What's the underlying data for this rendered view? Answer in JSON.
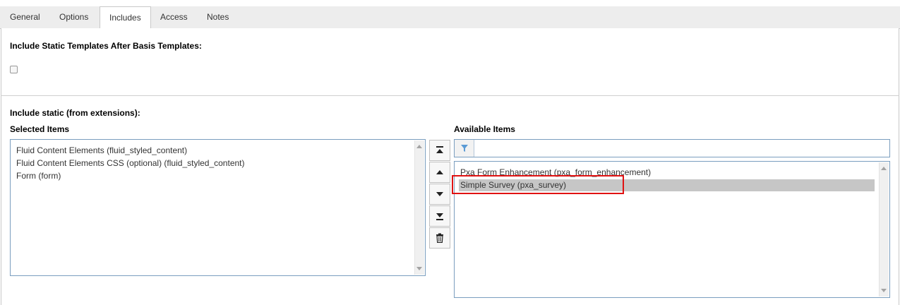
{
  "tabs": [
    {
      "label": "General",
      "active": false
    },
    {
      "label": "Options",
      "active": false
    },
    {
      "label": "Includes",
      "active": true
    },
    {
      "label": "Access",
      "active": false
    },
    {
      "label": "Notes",
      "active": false
    }
  ],
  "static_templates": {
    "label": "Include Static Templates After Basis Templates:",
    "checked": false
  },
  "include_static": {
    "label": "Include static (from extensions):",
    "selected": {
      "label": "Selected Items",
      "items": [
        "Fluid Content Elements (fluid_styled_content)",
        "Fluid Content Elements CSS (optional) (fluid_styled_content)",
        "Form (form)"
      ]
    },
    "available": {
      "label": "Available Items",
      "filter_value": "",
      "items": [
        "Pxa Form Enhancement (pxa_form_enhancement)",
        "Simple Survey (pxa_survey)"
      ],
      "selected_index": 1
    },
    "buttons": [
      "move-to-top",
      "move-up",
      "move-down",
      "move-to-bottom",
      "remove"
    ]
  },
  "colors": {
    "highlight": "#e01212",
    "list_border": "#7a9ebf",
    "selected_row": "#c6c6c6"
  }
}
